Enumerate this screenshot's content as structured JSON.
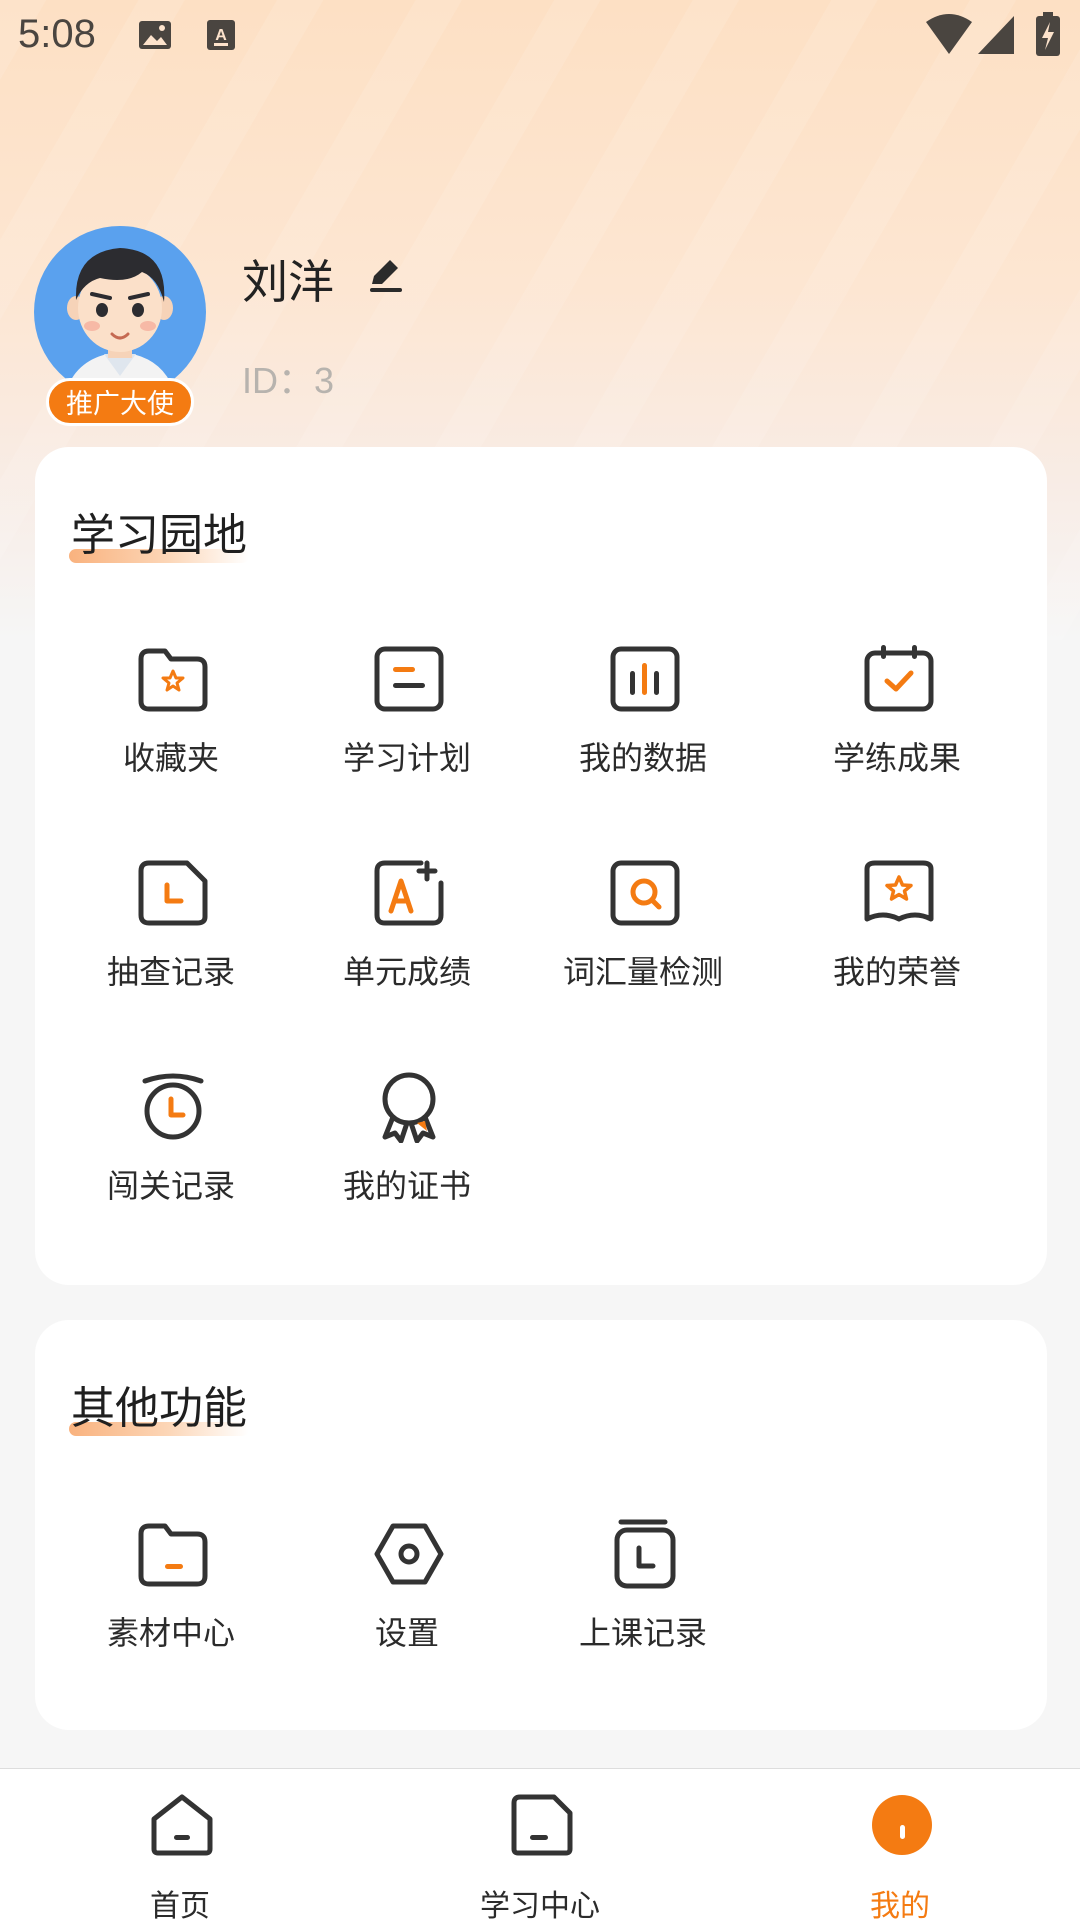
{
  "status_bar": {
    "time": "5:08"
  },
  "profile": {
    "name": "刘洋",
    "id_text": "ID：3",
    "badge": "推广大使"
  },
  "learning_section": {
    "title": "学习园地",
    "items": [
      {
        "label": "收藏夹",
        "icon": "folder-star-icon"
      },
      {
        "label": "学习计划",
        "icon": "plan-icon"
      },
      {
        "label": "我的数据",
        "icon": "bar-chart-icon"
      },
      {
        "label": "学练成果",
        "icon": "calendar-check-icon"
      },
      {
        "label": "抽查记录",
        "icon": "clock-doc-icon"
      },
      {
        "label": "单元成绩",
        "icon": "grade-a-plus-icon"
      },
      {
        "label": "词汇量检测",
        "icon": "search-box-icon"
      },
      {
        "label": "我的荣誉",
        "icon": "honor-star-icon"
      },
      {
        "label": "闯关记录",
        "icon": "alarm-clock-icon"
      },
      {
        "label": "我的证书",
        "icon": "certificate-ribbon-icon"
      }
    ]
  },
  "other_section": {
    "title": "其他功能",
    "items": [
      {
        "label": "素材中心",
        "icon": "folder-icon"
      },
      {
        "label": "设置",
        "icon": "settings-hex-icon"
      },
      {
        "label": "上课记录",
        "icon": "class-record-icon"
      }
    ]
  },
  "bottom_nav": {
    "items": [
      {
        "label": "首页",
        "icon": "home-icon"
      },
      {
        "label": "学习中心",
        "icon": "study-center-icon"
      },
      {
        "label": "我的",
        "icon": "profile-icon",
        "active": true
      }
    ]
  },
  "colors": {
    "accent": "#f47b12",
    "icon_stroke": "#333333",
    "avatar_bg": "#5aa1ee"
  }
}
